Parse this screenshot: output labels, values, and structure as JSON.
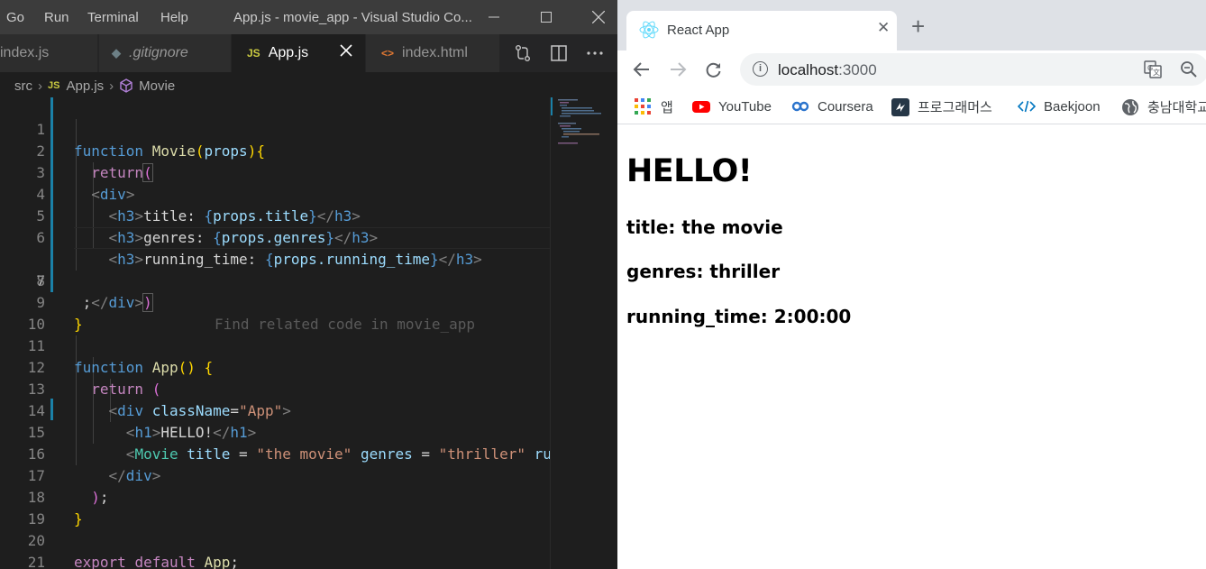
{
  "vscode": {
    "menu": [
      "Go",
      "Run",
      "Terminal",
      "Help"
    ],
    "window_title": "App.js - movie_app - Visual Studio Co...",
    "tabs": [
      {
        "icon": "JS",
        "label": "index.js",
        "active": false
      },
      {
        "icon": "◆",
        "label": ".gitignore",
        "active": false
      },
      {
        "icon": "JS",
        "label": "App.js",
        "active": true
      },
      {
        "icon": "<>",
        "label": "index.html",
        "active": false
      }
    ],
    "breadcrumb": [
      "src",
      "App.js",
      "Movie"
    ],
    "ghost_text": "Find related code in movie_app",
    "line_numbers": [
      "1",
      "2",
      "3",
      "4",
      "5",
      "6",
      "7",
      "8",
      "9",
      "10",
      "11",
      "12",
      "13",
      "14",
      "15",
      "16",
      "17",
      "18",
      "19",
      "20",
      "21"
    ],
    "tokens": {
      "function": "function",
      "movie": "Movie",
      "props": "props",
      "return": "return",
      "div": "div",
      "h3": "h3",
      "h1": "h1",
      "title_label": "title: ",
      "genres_label": "genres: ",
      "running_label": "running_time: ",
      "props_title": "props.title",
      "props_genres": "props.genres",
      "props_running": "props.running_time",
      "app": "App",
      "classname": "className",
      "app_str": "\"App\"",
      "hello": "HELLO!",
      "title_attr": "title",
      "the_movie": "\"the movie\"",
      "genres_attr": "genres",
      "thriller": "\"thriller\"",
      "ru": "ru",
      "export": "export",
      "default": "default"
    }
  },
  "chrome": {
    "tab_title": "React App",
    "url_host": "localhost",
    "url_port": ":3000",
    "bookmarks": [
      "앱",
      "YouTube",
      "Coursera",
      "프로그래머스",
      "Baekjoon",
      "충남대학교"
    ]
  },
  "page": {
    "heading": "HELLO!",
    "title_line": "title: the movie",
    "genres_line": "genres: thriller",
    "running_line": "running_time: 2:00:00"
  }
}
